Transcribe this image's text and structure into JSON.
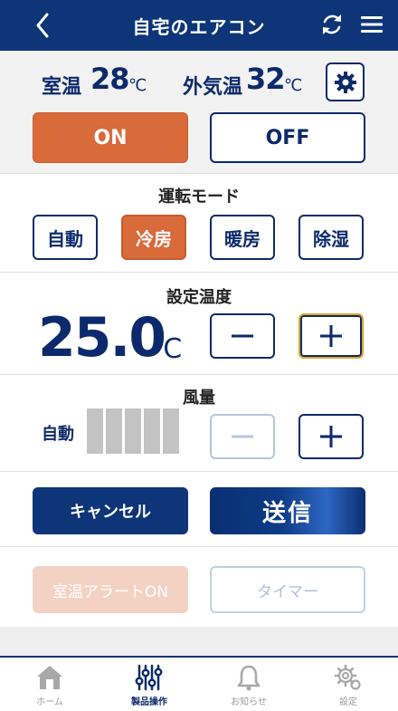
{
  "header": {
    "title": "自宅のエアコン"
  },
  "status": {
    "room_label": "室温",
    "room_temp": "28",
    "outdoor_label": "外気温",
    "outdoor_temp": "32",
    "unit": "℃"
  },
  "power": {
    "on_label": "ON",
    "off_label": "OFF",
    "selected": "ON"
  },
  "mode": {
    "title": "運転モード",
    "options": [
      "自動",
      "冷房",
      "暖房",
      "除湿"
    ],
    "selected": "冷房"
  },
  "setpoint": {
    "title": "設定温度",
    "value": "25.0",
    "unit": "℃"
  },
  "fan": {
    "title": "風量",
    "label": "自動",
    "level_bars": 5
  },
  "actions": {
    "cancel_label": "キャンセル",
    "send_label": "送信"
  },
  "options": {
    "alert_label": "室温アラートON",
    "timer_label": "タイマー"
  },
  "tabs": [
    {
      "label": "ホーム",
      "icon": "home-icon"
    },
    {
      "label": "製品操作",
      "icon": "sliders-icon",
      "active": true
    },
    {
      "label": "お知らせ",
      "icon": "bell-icon"
    },
    {
      "label": "設定",
      "icon": "gear-icon"
    }
  ],
  "colors": {
    "navy": "#0d3578",
    "accent_orange": "#d96a3a",
    "light_orange": "#f4d2c3"
  }
}
